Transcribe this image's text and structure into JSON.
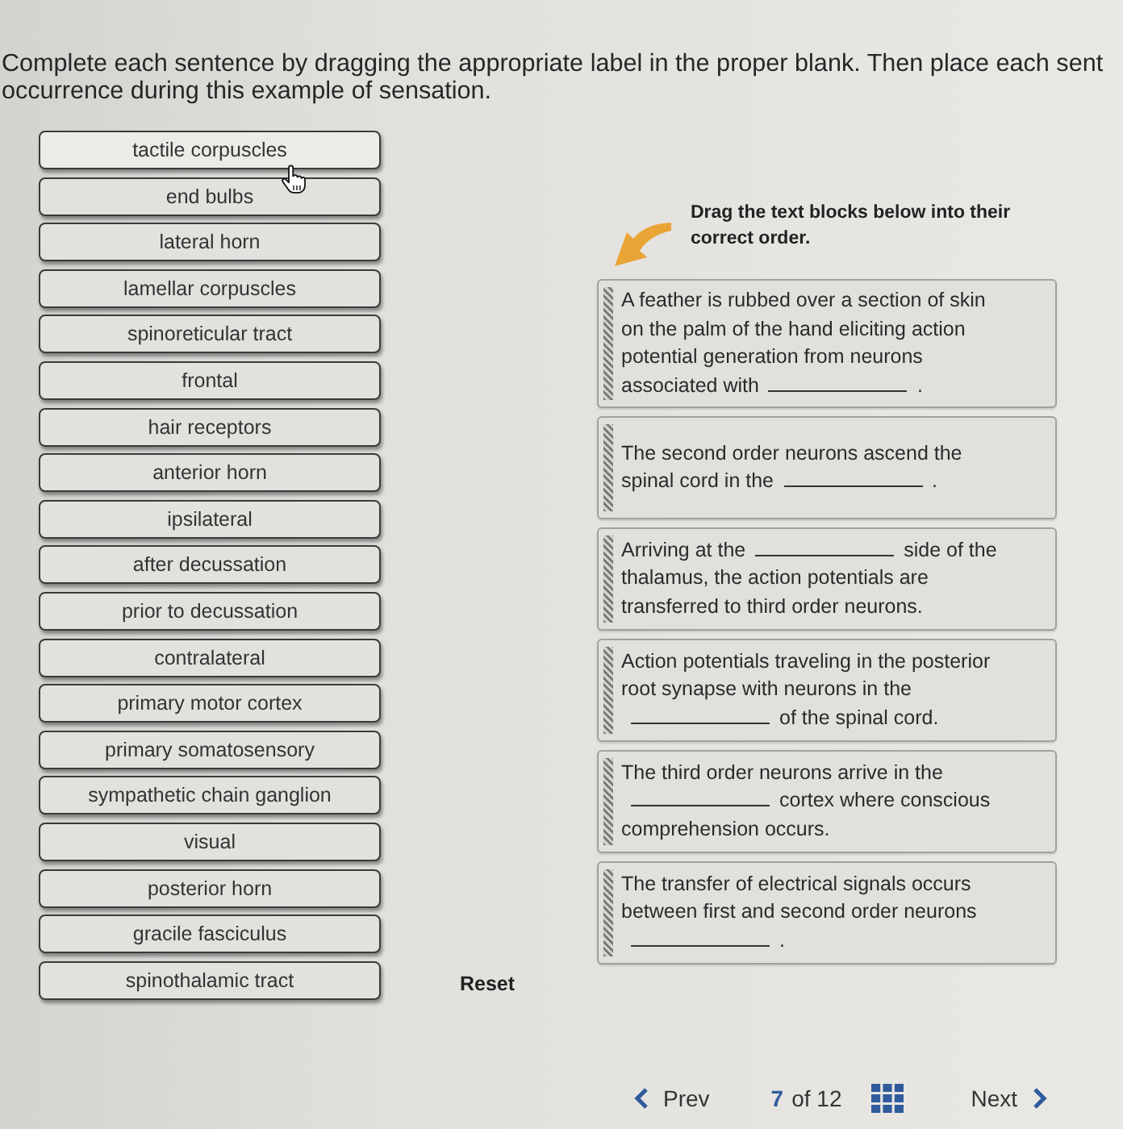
{
  "instructions": [
    "Complete each sentence by dragging the appropriate label in the proper blank. Then place each sent",
    "occurrence during this example of sensation."
  ],
  "labels": [
    {
      "text": "tactile corpuscles",
      "hovered": true
    },
    {
      "text": "end bulbs",
      "hovered": false
    },
    {
      "text": "lateral horn",
      "hovered": false
    },
    {
      "text": "lamellar corpuscles",
      "hovered": false
    },
    {
      "text": "spinoreticular tract",
      "hovered": false
    },
    {
      "text": "frontal",
      "hovered": false
    },
    {
      "text": "hair receptors",
      "hovered": false
    },
    {
      "text": "anterior horn",
      "hovered": false
    },
    {
      "text": "ipsilateral",
      "hovered": false
    },
    {
      "text": "after decussation",
      "hovered": false
    },
    {
      "text": "prior to decussation",
      "hovered": false
    },
    {
      "text": "contralateral",
      "hovered": false
    },
    {
      "text": "primary motor cortex",
      "hovered": false
    },
    {
      "text": "primary somatosensory",
      "hovered": false
    },
    {
      "text": "sympathetic chain ganglion",
      "hovered": false
    },
    {
      "text": "visual",
      "hovered": false
    },
    {
      "text": "posterior horn",
      "hovered": false
    },
    {
      "text": "gracile fasciculus",
      "hovered": false
    },
    {
      "text": "spinothalamic tract",
      "hovered": false
    }
  ],
  "reset": "Reset",
  "order_prompt": "Drag the text blocks below into their correct order.",
  "cards": [
    {
      "segments": [
        {
          "kind": "text",
          "text": "A feather is rubbed over a section of skin on the palm of the hand eliciting action potential generation from neurons associated with"
        },
        {
          "kind": "blank"
        },
        {
          "kind": "text",
          "text": "."
        }
      ]
    },
    {
      "segments": [
        {
          "kind": "text",
          "text": "The second order neurons ascend the spinal cord in the"
        },
        {
          "kind": "blank"
        },
        {
          "kind": "text",
          "text": "."
        }
      ]
    },
    {
      "segments": [
        {
          "kind": "text",
          "text": "Arriving at the"
        },
        {
          "kind": "blank"
        },
        {
          "kind": "text",
          "text": "side of the thalamus, the action potentials are transferred to third order neurons."
        }
      ]
    },
    {
      "segments": [
        {
          "kind": "text",
          "text": "Action potentials traveling in the posterior root synapse with neurons in the"
        },
        {
          "kind": "blank"
        },
        {
          "kind": "text",
          "text": "of the spinal cord."
        }
      ]
    },
    {
      "segments": [
        {
          "kind": "text",
          "text": "The third order neurons arrive in the"
        },
        {
          "kind": "blank"
        },
        {
          "kind": "text",
          "text": "cortex where conscious comprehension occurs."
        }
      ]
    },
    {
      "segments": [
        {
          "kind": "text",
          "text": "The transfer of electrical signals occurs between first and second order neurons"
        },
        {
          "kind": "blank"
        },
        {
          "kind": "text",
          "text": "."
        }
      ]
    }
  ],
  "pagination": {
    "prev": "Prev",
    "page": "7",
    "total": "of 12",
    "next": "Next"
  }
}
